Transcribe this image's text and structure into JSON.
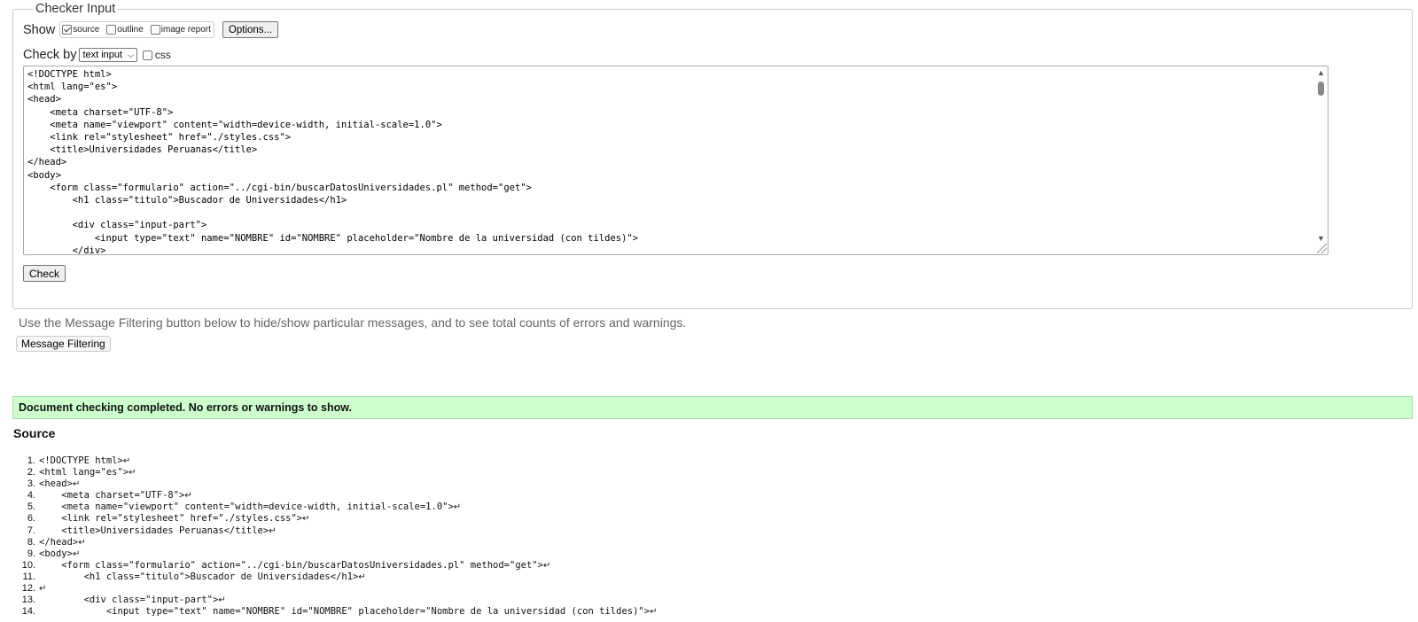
{
  "fieldset": {
    "legend": "Checker Input",
    "show_label": "Show",
    "show_options": [
      {
        "label": "source",
        "checked": true
      },
      {
        "label": "outline",
        "checked": false
      },
      {
        "label": "image report",
        "checked": false
      }
    ],
    "options_button": "Options...",
    "checkby_label": "Check by",
    "checkby_select": "text input",
    "css_label": "css",
    "css_checked": false,
    "textarea_lines": [
      "<!DOCTYPE html>",
      "<html lang=\"es\">",
      "<head>",
      "    <meta charset=\"UTF-8\">",
      "    <meta name=\"viewport\" content=\"width=device-width, initial-scale=1.0\">",
      "    <link rel=\"stylesheet\" href=\"./styles.css\">",
      "    <title>Universidades Peruanas</title>",
      "</head>",
      "<body>",
      "    <form class=\"formulario\" action=\"../cgi-bin/buscarDatosUniversidades.pl\" method=\"get\">",
      "        <h1 class=\"titulo\">Buscador de Universidades</h1>",
      "",
      "        <div class=\"input-part\">",
      "            <input type=\"text\" name=\"NOMBRE\" id=\"NOMBRE\" placeholder=\"Nombre de la universidad (con tildes)\">",
      "        </div>"
    ],
    "check_button": "Check"
  },
  "filter_info": "Use the Message Filtering button below to hide/show particular messages, and to see total counts of errors and warnings.",
  "filter_button": "Message Filtering",
  "result_message": "Document checking completed. No errors or warnings to show.",
  "source_heading": "Source",
  "source_lines": [
    {
      "num": "1.",
      "code": "<!DOCTYPE html>"
    },
    {
      "num": "2.",
      "code": "<html lang=\"es\">"
    },
    {
      "num": "3.",
      "code": "<head>"
    },
    {
      "num": "4.",
      "code": "    <meta charset=\"UTF-8\">"
    },
    {
      "num": "5.",
      "code": "    <meta name=\"viewport\" content=\"width=device-width, initial-scale=1.0\">"
    },
    {
      "num": "6.",
      "code": "    <link rel=\"stylesheet\" href=\"./styles.css\">"
    },
    {
      "num": "7.",
      "code": "    <title>Universidades Peruanas</title>"
    },
    {
      "num": "8.",
      "code": "</head>"
    },
    {
      "num": "9.",
      "code": "<body>"
    },
    {
      "num": "10.",
      "code": "    <form class=\"formulario\" action=\"../cgi-bin/buscarDatosUniversidades.pl\" method=\"get\">"
    },
    {
      "num": "11.",
      "code": "        <h1 class=\"titulo\">Buscador de Universidades</h1>"
    },
    {
      "num": "12.",
      "code": ""
    },
    {
      "num": "13.",
      "code": "        <div class=\"input-part\">"
    },
    {
      "num": "14.",
      "code": "            <input type=\"text\" name=\"NOMBRE\" id=\"NOMBRE\" placeholder=\"Nombre de la universidad (con tildes)\">"
    }
  ],
  "return_glyph": "↵",
  "colors": {
    "success_bg": "#ccffcc",
    "success_border": "#aaddaa"
  }
}
